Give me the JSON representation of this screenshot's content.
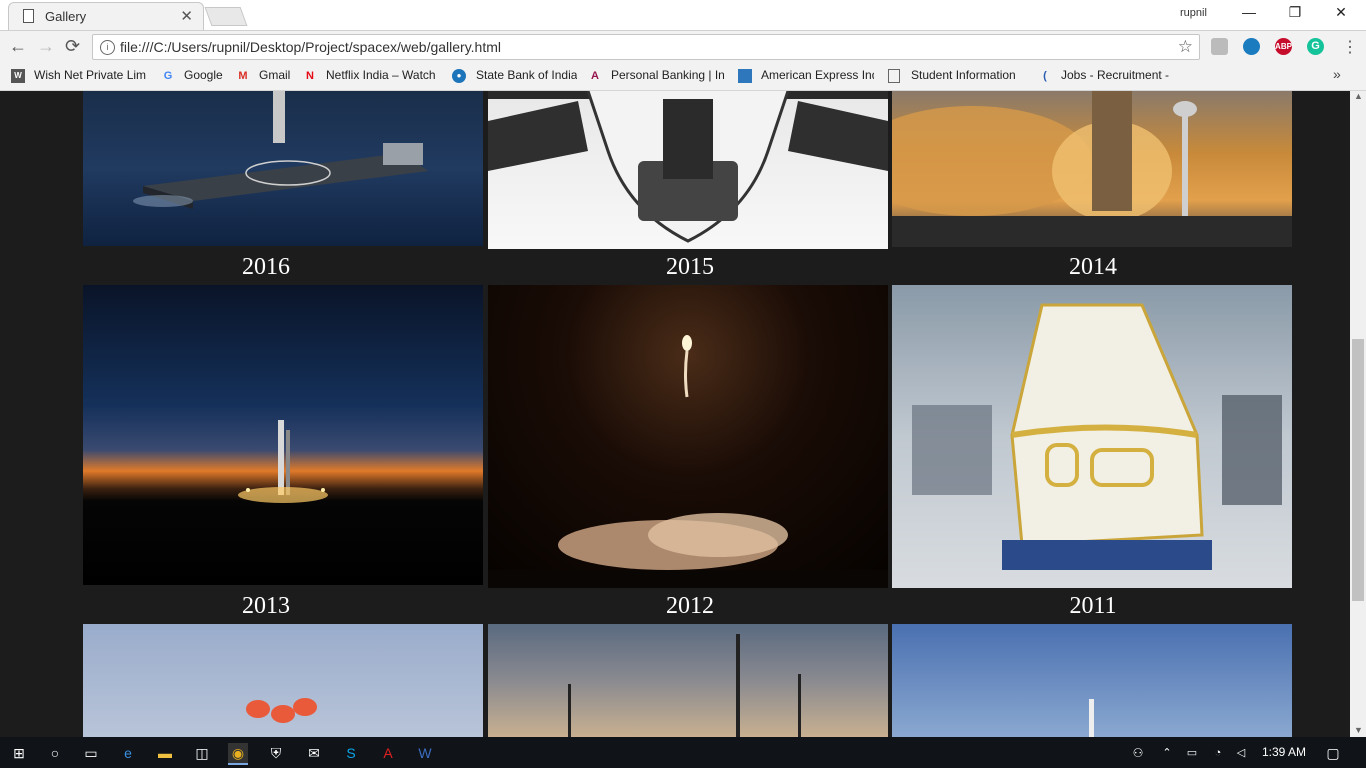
{
  "browser": {
    "tab_title": "Gallery",
    "tab_close": "✕",
    "user_name": "rupnil",
    "url": "file:///C:/Users/rupnil/Desktop/Project/spacex/web/gallery.html",
    "window_controls": {
      "minimize": "—",
      "restore": "❐",
      "close": "✕"
    },
    "nav": {
      "back": "←",
      "forward": "→",
      "reload": "⟳"
    },
    "star": "☆",
    "menu": "⋮",
    "extensions": [
      {
        "name": "evernote-icon",
        "label": ""
      },
      {
        "name": "eye-icon",
        "label": ""
      },
      {
        "name": "adblock-icon",
        "label": "ABP",
        "color": "#c70d2c"
      },
      {
        "name": "grammarly-icon",
        "label": "G",
        "color": "#15c39a"
      }
    ]
  },
  "bookmarks": [
    {
      "label": "Wish Net Private Limi",
      "icon": "wishnet-icon"
    },
    {
      "label": "Google",
      "icon": "google-icon"
    },
    {
      "label": "Gmail",
      "icon": "gmail-icon"
    },
    {
      "label": "Netflix India – Watch",
      "icon": "netflix-icon"
    },
    {
      "label": "State Bank of India",
      "icon": "sbi-icon"
    },
    {
      "label": "Personal Banking | Int",
      "icon": "axis-icon"
    },
    {
      "label": "American Express Ind",
      "icon": "amex-icon"
    },
    {
      "label": "Student Information",
      "icon": "document-icon"
    },
    {
      "label": "Jobs - Recruitment -",
      "icon": "jobs-icon"
    }
  ],
  "bookmarks_more": "»",
  "gallery": {
    "row1": [
      "2016",
      "2015",
      "2014"
    ],
    "row2": [
      "2013",
      "2012",
      "2011"
    ]
  },
  "taskbar": {
    "time": "1:39 AM",
    "icons": [
      "windows-start-icon",
      "cortana-icon",
      "task-view-icon",
      "edge-icon",
      "file-explorer-icon",
      "store-icon",
      "chrome-icon",
      "security-icon",
      "mail-icon",
      "skype-icon",
      "acrobat-icon",
      "word-icon"
    ]
  }
}
